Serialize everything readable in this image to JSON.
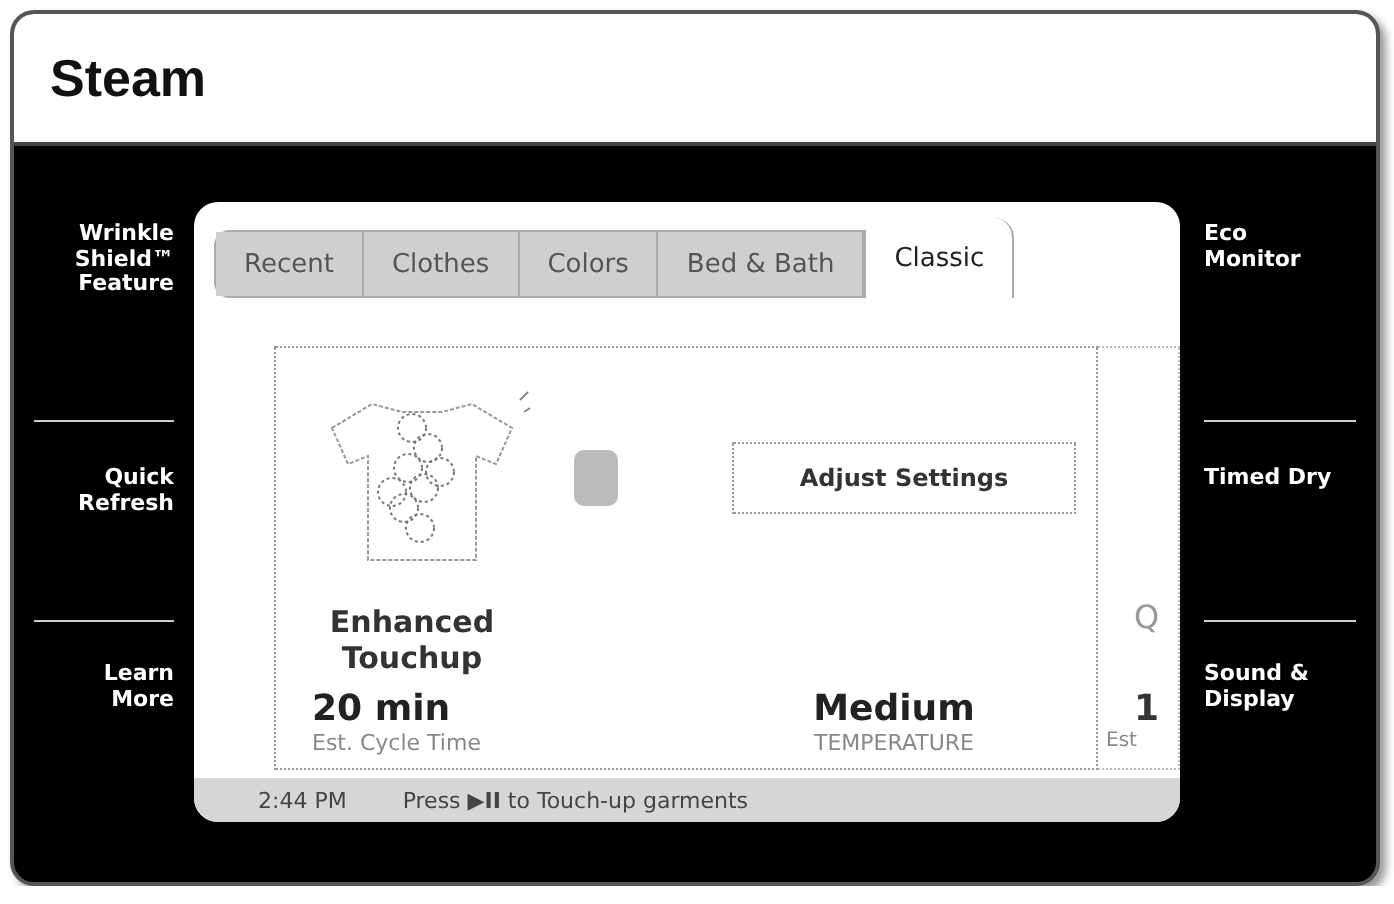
{
  "title": "Steam",
  "left_menu": [
    {
      "label": "Wrinkle Shield™ Feature"
    },
    {
      "label": "Quick Refresh"
    },
    {
      "label": "Learn More"
    }
  ],
  "right_menu": [
    {
      "label": "Eco Monitor"
    },
    {
      "label": "Timed Dry"
    },
    {
      "label": "Sound & Display"
    }
  ],
  "tabs": [
    {
      "label": "Recent",
      "selected": false
    },
    {
      "label": "Clothes",
      "selected": false
    },
    {
      "label": "Colors",
      "selected": false
    },
    {
      "label": "Bed & Bath",
      "selected": false
    },
    {
      "label": "Classic",
      "selected": true
    }
  ],
  "cycle": {
    "name": "Enhanced Touchup",
    "button": "Adjust Settings",
    "time": "20 min",
    "time_label": "Est. Cycle Time",
    "temperature": "Medium",
    "temperature_label": "TEMPERATURE"
  },
  "next_cycle": {
    "name": "Q",
    "time": "1",
    "time_label": "Est"
  },
  "status_bar": {
    "time": "2:44 PM",
    "message": "Press **▶II** to Touch-up garments"
  }
}
